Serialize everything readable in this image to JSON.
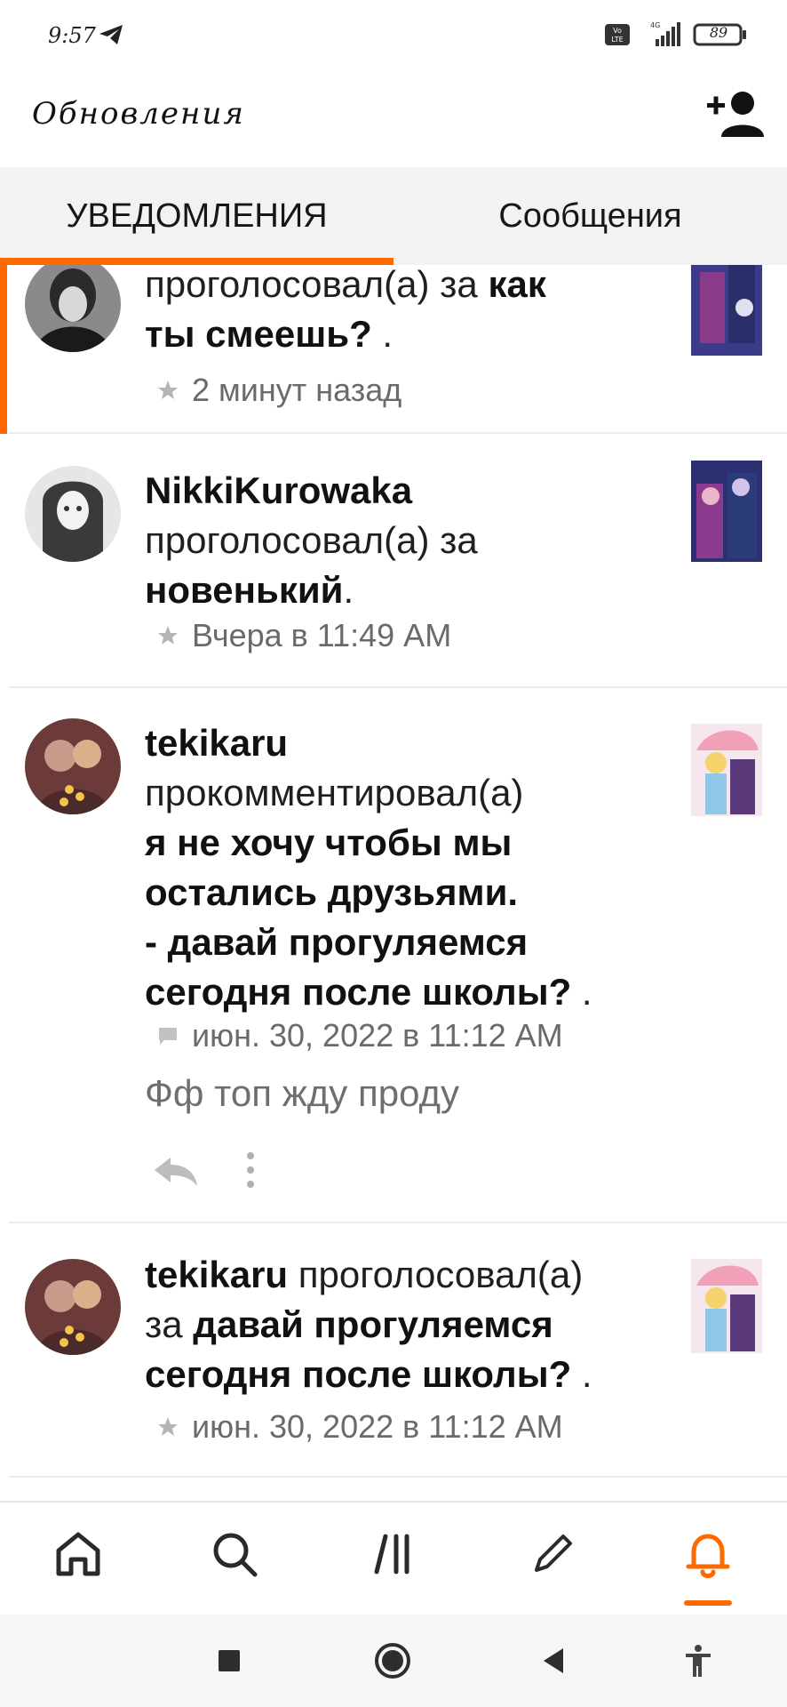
{
  "status_bar": {
    "time": "9:57",
    "battery": "89",
    "icons": [
      "telegram-icon",
      "volte-icon",
      "signal-4g-icon",
      "battery-icon"
    ]
  },
  "header": {
    "title": "Обновления",
    "add_user_icon": "add-user-icon"
  },
  "tabs": [
    {
      "label": "УВЕДОМЛЕНИЯ",
      "active": true
    },
    {
      "label": "Сообщения",
      "active": false
    }
  ],
  "accent_color": "#ff6a00",
  "notifications": [
    {
      "line1": "проголосовал(а) за ",
      "bold1": "как",
      "bold2": "ты смеешь?",
      "tail": " .",
      "time": "2 минут назад",
      "icon": "star-icon",
      "unread": true
    },
    {
      "user": "NikkiKurowaka",
      "action": "проголосовал(а) за",
      "work": "новенький",
      "tail": ".",
      "time": "Вчера в 11:49 AM",
      "icon": "star-icon"
    },
    {
      "user": "tekikaru",
      "action": "прокомментировал(а)",
      "work_lines": [
        "я не хочу чтобы мы",
        "остались друзьями.",
        "- давай прогуляемся"
      ],
      "work_last": "сегодня после школы?",
      "tail": " .",
      "time": "июн. 30, 2022 в 11:12 AM",
      "icon": "comment-icon",
      "comment": "Фф топ жду проду",
      "actions": [
        "reply-icon",
        "more-vertical-icon"
      ]
    },
    {
      "user": "tekikaru",
      "action": " проголосовал(а)",
      "prefix2": "за ",
      "work_a": "давай прогуляемся",
      "work_b": "сегодня после школы?",
      "tail": " .",
      "time": "июн. 30, 2022 в 11:12 AM",
      "icon": "star-icon"
    }
  ],
  "bottom_nav": [
    {
      "name": "home",
      "icon": "home-icon"
    },
    {
      "name": "search",
      "icon": "search-icon"
    },
    {
      "name": "library",
      "icon": "library-icon"
    },
    {
      "name": "write",
      "icon": "pencil-icon"
    },
    {
      "name": "notifications",
      "icon": "bell-icon",
      "active": true
    }
  ],
  "system_nav": [
    "recents-square-icon",
    "home-circle-icon",
    "back-triangle-icon",
    "accessibility-icon"
  ]
}
